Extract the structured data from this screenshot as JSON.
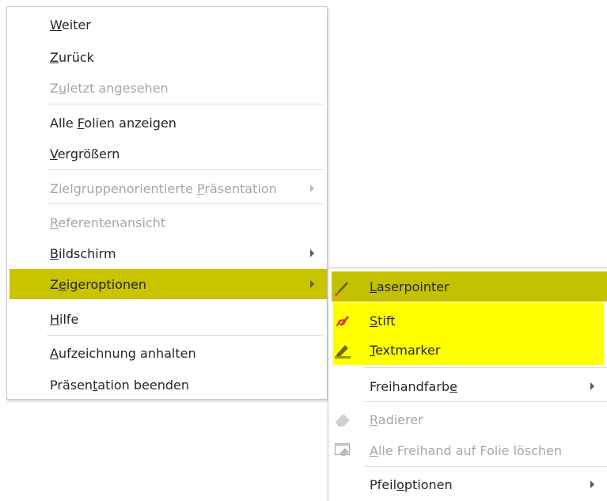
{
  "main_menu": {
    "items": [
      {
        "pre": "",
        "acc": "W",
        "post": "eiter"
      },
      {
        "pre": "",
        "acc": "Z",
        "post": "urück"
      },
      {
        "pre": "Z",
        "acc": "u",
        "post": "letzt angesehen"
      },
      {
        "pre": "Alle ",
        "acc": "F",
        "post": "olien anzeigen"
      },
      {
        "pre": "",
        "acc": "V",
        "post": "ergrößern"
      },
      {
        "pre": "Zielgruppenorientierte ",
        "acc": "P",
        "post": "räsentation"
      },
      {
        "pre": "",
        "acc": "R",
        "post": "eferentenansicht"
      },
      {
        "pre": "",
        "acc": "B",
        "post": "ildschirm"
      },
      {
        "pre": "Z",
        "acc": "e",
        "post": "igeroptionen"
      },
      {
        "pre": "",
        "acc": "H",
        "post": "ilfe"
      },
      {
        "pre": "",
        "acc": "A",
        "post": "ufzeichnung anhalten"
      },
      {
        "pre": "Präsen",
        "acc": "t",
        "post": "ation beenden"
      }
    ]
  },
  "sub_menu": {
    "items": [
      {
        "pre": "",
        "acc": "L",
        "post": "aserpointer",
        "icon": "laser-pointer-pen-icon"
      },
      {
        "pre": "",
        "acc": "S",
        "post": "tift",
        "icon": "pen-icon"
      },
      {
        "pre": "",
        "acc": "T",
        "post": "extmarker",
        "icon": "highlighter-icon"
      },
      {
        "pre": "Freihandfarb",
        "acc": "e",
        "post": "",
        "icon": ""
      },
      {
        "pre": "",
        "acc": "R",
        "post": "adierer",
        "icon": "eraser-icon"
      },
      {
        "pre": "",
        "acc": "A",
        "post": "lle Freihand auf Folie löschen",
        "icon": "erase-all-ink-icon"
      },
      {
        "pre": "Pfeil",
        "acc": "o",
        "post": "ptionen",
        "icon": ""
      }
    ]
  },
  "colors": {
    "selected": "#c4c200",
    "highlight_yellow": "#ffff00",
    "text": "#262626",
    "disabled_text": "#a6a6a6"
  }
}
